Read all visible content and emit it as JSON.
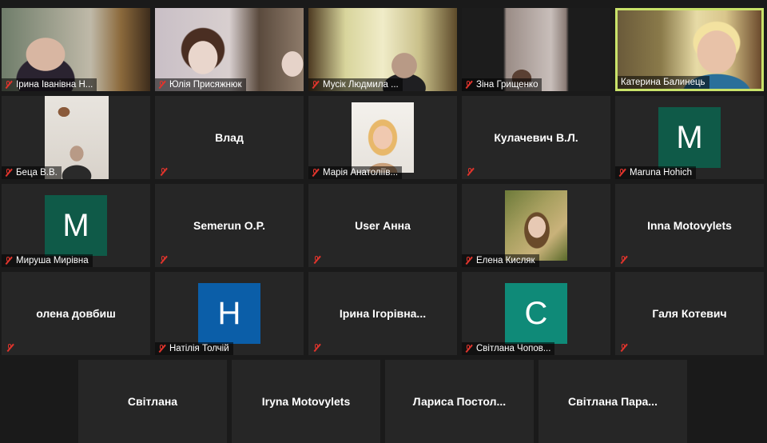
{
  "colors": {
    "speaking_border": "#c9e26a",
    "muted_icon": "#e0342c",
    "tile_bg": "#262626",
    "bg": "#1a1a1a"
  },
  "participants": [
    {
      "name": "Ірина Іванівна Н...",
      "kind": "video",
      "muted": true
    },
    {
      "name": "Юлія Присяжнюк",
      "kind": "video",
      "muted": true
    },
    {
      "name": "Мусік Людмила ...",
      "kind": "video",
      "muted": true
    },
    {
      "name": "Зіна Грищенко",
      "kind": "video",
      "muted": true
    },
    {
      "name": "Катерина Балинець",
      "kind": "video",
      "muted": false,
      "speaking": true
    },
    {
      "name": "Беца В.В.",
      "kind": "video",
      "muted": true
    },
    {
      "name": "Влад",
      "kind": "text",
      "muted": true
    },
    {
      "name": "Марія Анатоліїв...",
      "kind": "photo",
      "muted": true
    },
    {
      "name": "Кулачевич В.Л.",
      "kind": "text",
      "muted": true
    },
    {
      "name": "Maruna Hohich",
      "kind": "letter",
      "letter": "M",
      "letter_color": "#0f5a48",
      "muted": true
    },
    {
      "name": "Мируша Мирівна",
      "kind": "letter",
      "letter": "M",
      "letter_color": "#0f5a48",
      "muted": true
    },
    {
      "name": "Semerun O.P.",
      "kind": "text",
      "muted": true
    },
    {
      "name": "User Анна",
      "kind": "text",
      "muted": true
    },
    {
      "name": "Елена Кисляк",
      "kind": "photo",
      "muted": true
    },
    {
      "name": "Inna Motovylets",
      "kind": "text",
      "muted": true
    },
    {
      "name": "олена довбиш",
      "kind": "text",
      "muted": true
    },
    {
      "name": "Натілія Толчій",
      "kind": "letter",
      "letter": "H",
      "letter_color": "#0b5ea8",
      "muted": true
    },
    {
      "name": "Ірина Ігорівна...",
      "kind": "text",
      "muted": true
    },
    {
      "name": "Світлана Чопов...",
      "kind": "letter",
      "letter": "C",
      "letter_color": "#0f8a78",
      "muted": true
    },
    {
      "name": "Галя Котевич",
      "kind": "text",
      "muted": true
    },
    {
      "name": "Світлана",
      "kind": "text",
      "muted": false
    },
    {
      "name": "Iryna Motovylets",
      "kind": "text",
      "muted": false
    },
    {
      "name": "Лариса  Постол...",
      "kind": "text",
      "muted": false
    },
    {
      "name": "Світлана  Пара...",
      "kind": "text",
      "muted": false
    }
  ]
}
